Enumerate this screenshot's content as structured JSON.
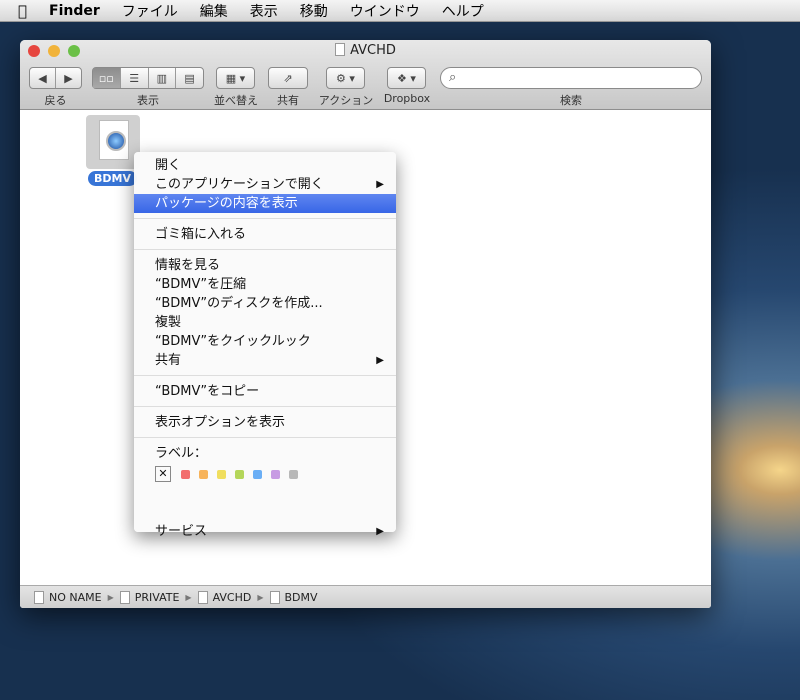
{
  "menubar": {
    "apple": "",
    "app": "Finder",
    "items": [
      "ファイル",
      "編集",
      "表示",
      "移動",
      "ウインドウ",
      "ヘルプ"
    ]
  },
  "window": {
    "title": "AVCHD",
    "toolbar": {
      "back_label": "戻る",
      "view_label": "表示",
      "arrange_label": "並べ替え",
      "share_label": "共有",
      "action_label": "アクション",
      "dropbox_label": "Dropbox",
      "search_label": "検索",
      "search_value": ""
    },
    "file": {
      "name": "BDMV"
    },
    "path": [
      "NO NAME",
      "PRIVATE",
      "AVCHD",
      "BDMV"
    ]
  },
  "context_menu": {
    "groups": [
      [
        "開く",
        "このアプリケーションで開く",
        "パッケージの内容を表示"
      ],
      [
        "ゴミ箱に入れる"
      ],
      [
        "情報を見る",
        "“BDMV”を圧縮",
        "“BDMV”のディスクを作成...",
        "複製",
        "“BDMV”をクイックルック",
        "共有"
      ],
      [
        "“BDMV”をコピー"
      ],
      [
        "表示オプションを表示"
      ]
    ],
    "label_title": "ラベル：",
    "label_colors": [
      "#f26d6d",
      "#f7b35a",
      "#f0de5e",
      "#b4d65a",
      "#6aaef5",
      "#c79be3",
      "#b8b8b8"
    ],
    "services": "サービス",
    "highlighted": "パッケージの内容を表示"
  }
}
